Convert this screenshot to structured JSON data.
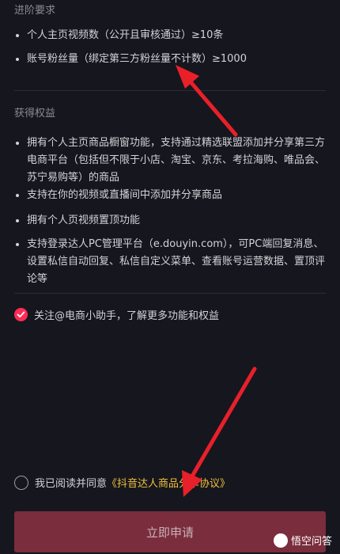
{
  "requirements": {
    "title": "进阶要求",
    "items": [
      "个人主页视频数（公开且审核通过）≥10条",
      "账号粉丝量（绑定第三方粉丝量不计数）≥1000"
    ]
  },
  "benefits": {
    "title": "获得权益",
    "items": [
      "拥有个人主页商品橱窗功能，支持通过精选联盟添加并分享第三方电商平台（包括但不限于小店、淘宝、京东、考拉海购、唯品会、苏宁易购等）的商品",
      "支持在你的视频或直播间中添加并分享商品",
      "拥有个人页视频置顶功能",
      "支持登录达人PC管理平台（e.douyin.com），可PC端回复消息、设置私信自动回复、私信自定义菜单、查看账号运营数据、置顶评论等"
    ]
  },
  "follow_checkbox": {
    "label": "关注@电商小助手，了解更多功能和权益",
    "checked": true
  },
  "agreement": {
    "prefix": "我已阅读并同意",
    "link": "《抖音达人商品分享协议》",
    "checked": false
  },
  "apply_button": {
    "label": "立即申请"
  },
  "watermark": {
    "text": "悟空问答"
  },
  "colors": {
    "accent": "#fe2c55",
    "link": "#f0c23c",
    "arrow": "#e8202a"
  }
}
